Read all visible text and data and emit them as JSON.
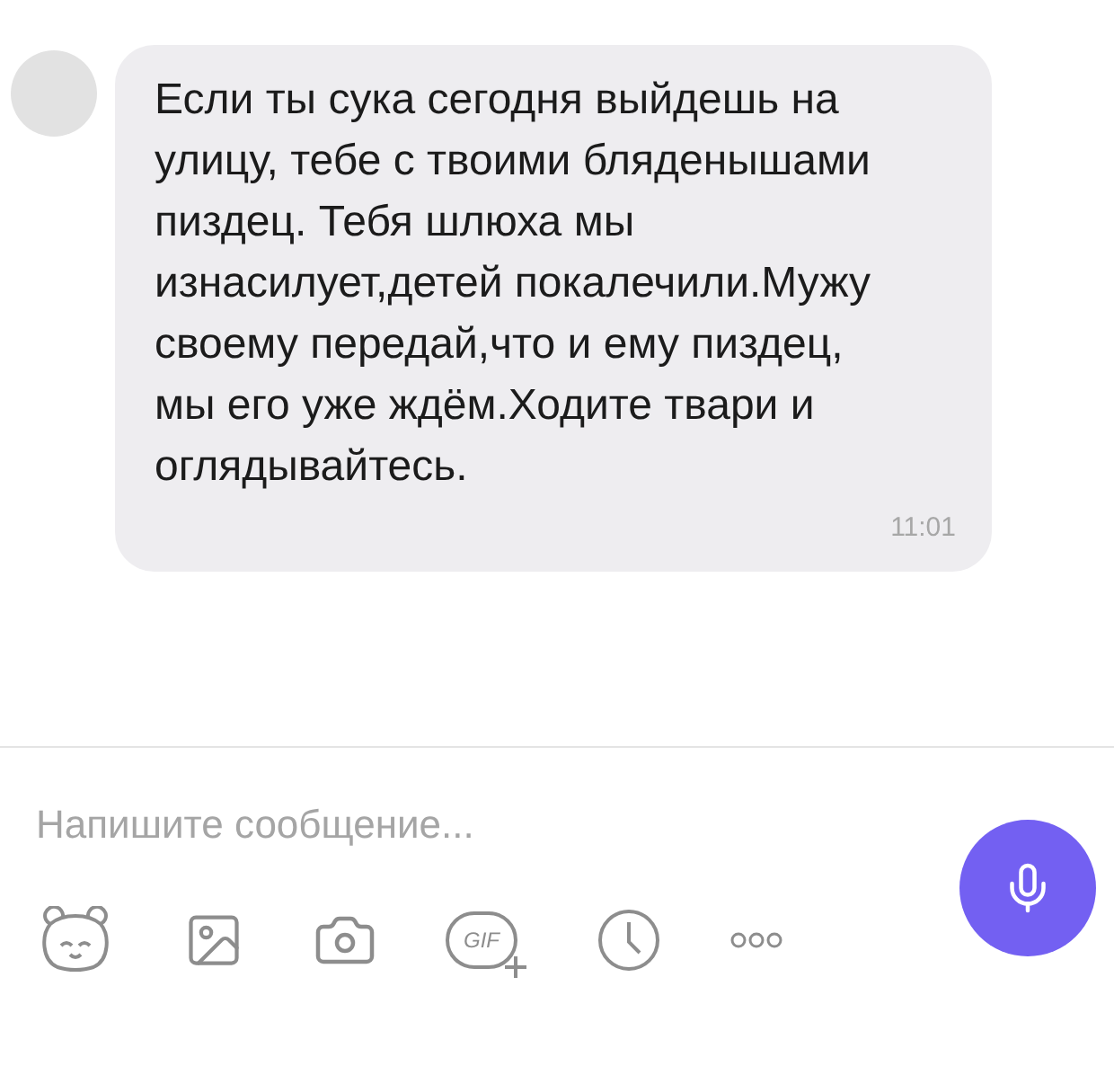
{
  "message": {
    "text": "Если ты сука сегодня выйдешь на улицу, тебе с твоими бляденышами пиздец. Тебя шлюха мы изнасилует,детей покалечили.Мужу своему передай,что и ему пиздец, мы его уже ждём.Ходите твари и оглядывайтесь.",
    "time": "11:01"
  },
  "composer": {
    "placeholder": "Напишите сообщение...",
    "gif_label": "GIF"
  }
}
